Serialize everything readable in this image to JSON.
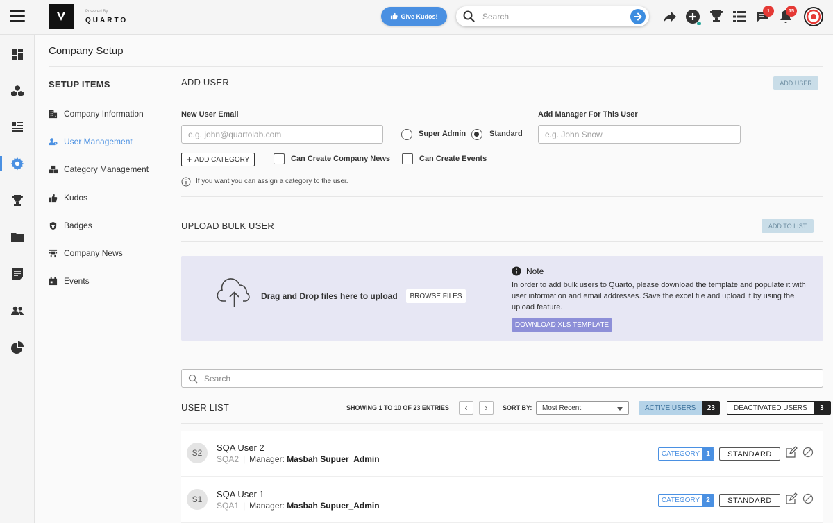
{
  "header": {
    "powered_by": "Powered By",
    "brand": "QUARTO",
    "kudos_label": "Give Kudos!",
    "search_placeholder": "Search",
    "messages_badge": "1",
    "notifications_badge": "15"
  },
  "page": {
    "title": "Company Setup"
  },
  "sidebar": {
    "heading": "SETUP ITEMS",
    "items": [
      {
        "label": "Company Information",
        "icon": "building-icon"
      },
      {
        "label": "User Management",
        "icon": "users-cog-icon",
        "active": true
      },
      {
        "label": "Category Management",
        "icon": "boxes-icon"
      },
      {
        "label": "Kudos",
        "icon": "thumbs-up-icon"
      },
      {
        "label": "Badges",
        "icon": "badge-icon"
      },
      {
        "label": "Company News",
        "icon": "news-icon"
      },
      {
        "label": "Events",
        "icon": "calendar-icon"
      }
    ]
  },
  "add_user": {
    "title": "ADD USER",
    "button": "ADD USER",
    "email_label": "New User Email",
    "email_placeholder": "e.g. john@quartolab.com",
    "role_options": [
      "Super Admin",
      "Standard"
    ],
    "role_selected": "Standard",
    "manager_label": "Add Manager For This User",
    "manager_placeholder": "e.g. John Snow",
    "add_category_button": "ADD CATEGORY",
    "can_create_news": "Can Create Company News",
    "can_create_events": "Can Create Events",
    "hint": "If you want you can assign a category to the user."
  },
  "bulk": {
    "title": "UPLOAD BULK USER",
    "button": "ADD TO LIST",
    "drag_text": "Drag and Drop files here to upload",
    "browse_button": "BROWSE FILES",
    "note_title": "Note",
    "note_lines": [
      "In order to add bulk users to Quarto, please download the template and populate it with",
      "user information and email addresses. Save the excel file and upload it by using the",
      "upload feature."
    ],
    "download_button": "DOWNLOAD XLS TEMPLATE"
  },
  "user_list": {
    "search_placeholder": "Search",
    "title": "USER LIST",
    "showing": "SHOWING 1 TO 10 OF 23 ENTRIES",
    "sort_label": "SORT BY:",
    "sort_value": "Most Recent",
    "active_label": "ACTIVE USERS",
    "active_count": "23",
    "deactivated_label": "DEACTIVATED USERS",
    "deactivated_count": "3",
    "rows": [
      {
        "initials": "S2",
        "name": "SQA User 2",
        "username": "SQA2",
        "manager_label": "Manager:",
        "manager": "Masbah Supuer_Admin",
        "category_label": "CATEGORY",
        "category_count": "1",
        "role": "STANDARD"
      },
      {
        "initials": "S1",
        "name": "SQA User 1",
        "username": "SQA1",
        "manager_label": "Manager:",
        "manager": "Masbah Supuer_Admin",
        "category_label": "CATEGORY",
        "category_count": "2",
        "role": "STANDARD"
      }
    ]
  },
  "colors": {
    "accent": "#4a90e2",
    "upload_bg": "#e7e7f4",
    "download_btn": "#8d8fd8",
    "badge_red": "#e53935"
  }
}
